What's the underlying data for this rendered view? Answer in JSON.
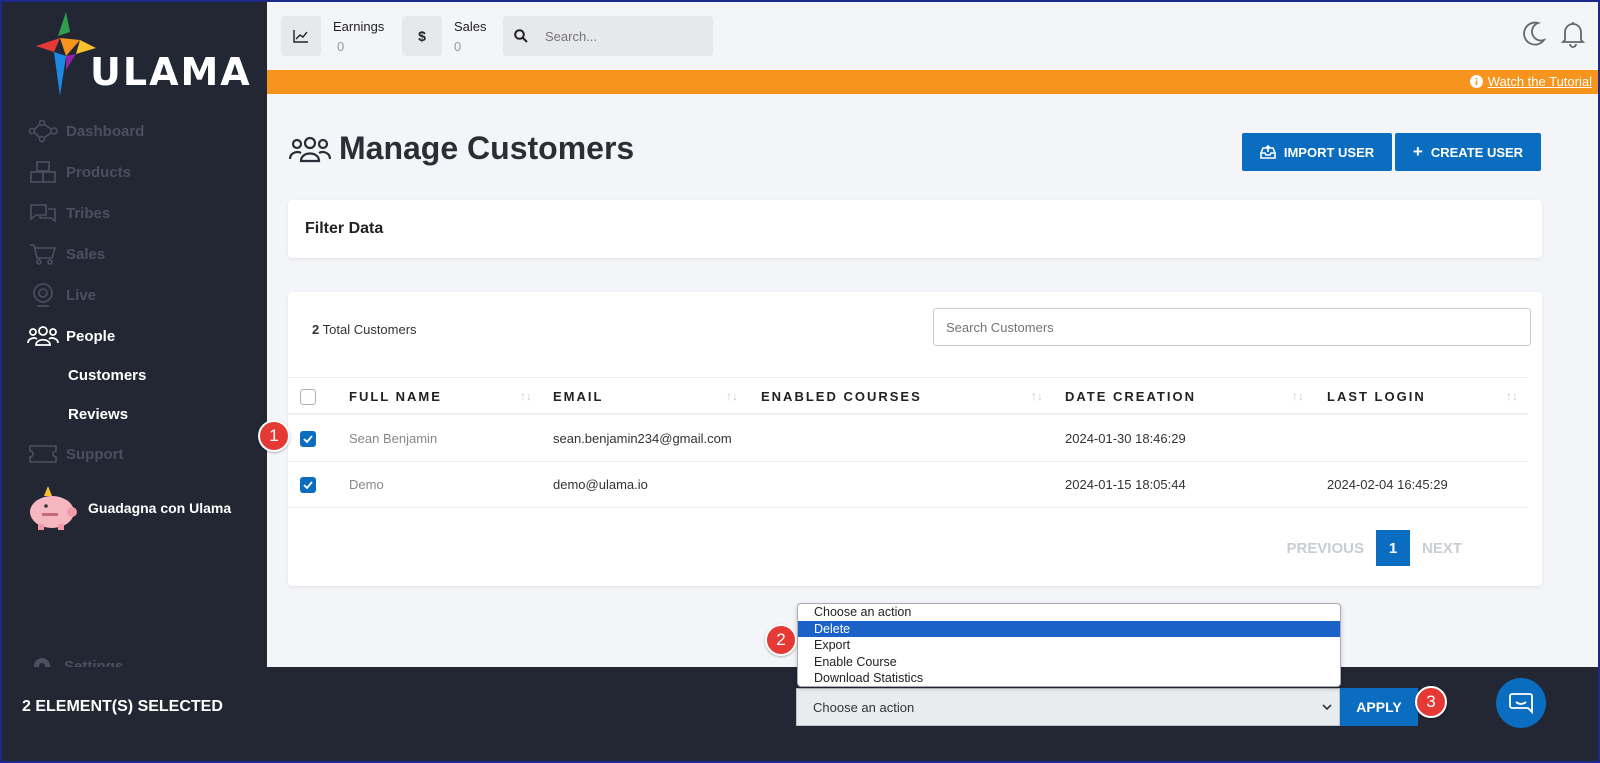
{
  "brand": {
    "name": "ULAMA"
  },
  "sidebar": {
    "items": [
      {
        "label": "Dashboard",
        "icon": "network-icon"
      },
      {
        "label": "Products",
        "icon": "boxes-icon"
      },
      {
        "label": "Tribes",
        "icon": "chat-bubbles-icon"
      },
      {
        "label": "Sales",
        "icon": "cart-icon"
      },
      {
        "label": "Live",
        "icon": "webcam-icon"
      },
      {
        "label": "People",
        "icon": "people-icon"
      }
    ],
    "subitems": [
      {
        "label": "Customers"
      },
      {
        "label": "Reviews"
      }
    ],
    "support": {
      "label": "Support"
    },
    "promo": {
      "label": "Guadagna con Ulama"
    },
    "settings": {
      "label": "Settings"
    }
  },
  "topbar": {
    "earnings": {
      "label": "Earnings",
      "value": "0"
    },
    "sales": {
      "label": "Sales",
      "value": "0"
    },
    "search": {
      "placeholder": "Search..."
    }
  },
  "banner": {
    "link": "Watch the Tutorial",
    "color": "#f7941d"
  },
  "main": {
    "title": "Manage Customers",
    "import_button": "IMPORT USER",
    "create_button": "CREATE USER",
    "filter_title": "Filter Data",
    "total_count": "2",
    "total_label": "Total Customers",
    "search_placeholder": "Search Customers"
  },
  "table": {
    "columns": [
      "FULL NAME",
      "EMAIL",
      "ENABLED COURSES",
      "DATE CREATION",
      "LAST LOGIN"
    ],
    "rows": [
      {
        "name": "Sean Benjamin",
        "email": "sean.benjamin234@gmail.com",
        "courses": "",
        "created": "2024-01-30 18:46:29",
        "last_login": "",
        "checked": true
      },
      {
        "name": "Demo",
        "email": "demo@ulama.io",
        "courses": "",
        "created": "2024-01-15 18:05:44",
        "last_login": "2024-02-04 16:45:29",
        "checked": true
      }
    ]
  },
  "pagination": {
    "previous": "PREVIOUS",
    "current": "1",
    "next": "NEXT"
  },
  "bulk": {
    "selected_label": "2 ELEMENT(S) SELECTED",
    "select_value": "Choose an action",
    "apply": "APPLY",
    "options": [
      "Choose an action",
      "Delete",
      "Export",
      "Enable Course",
      "Download Statistics"
    ],
    "highlighted": "Delete"
  },
  "steps": [
    "1",
    "2",
    "3"
  ],
  "colors": {
    "accent": "#0a6dbf",
    "sidebar": "#222733",
    "badge": "#e53935"
  }
}
